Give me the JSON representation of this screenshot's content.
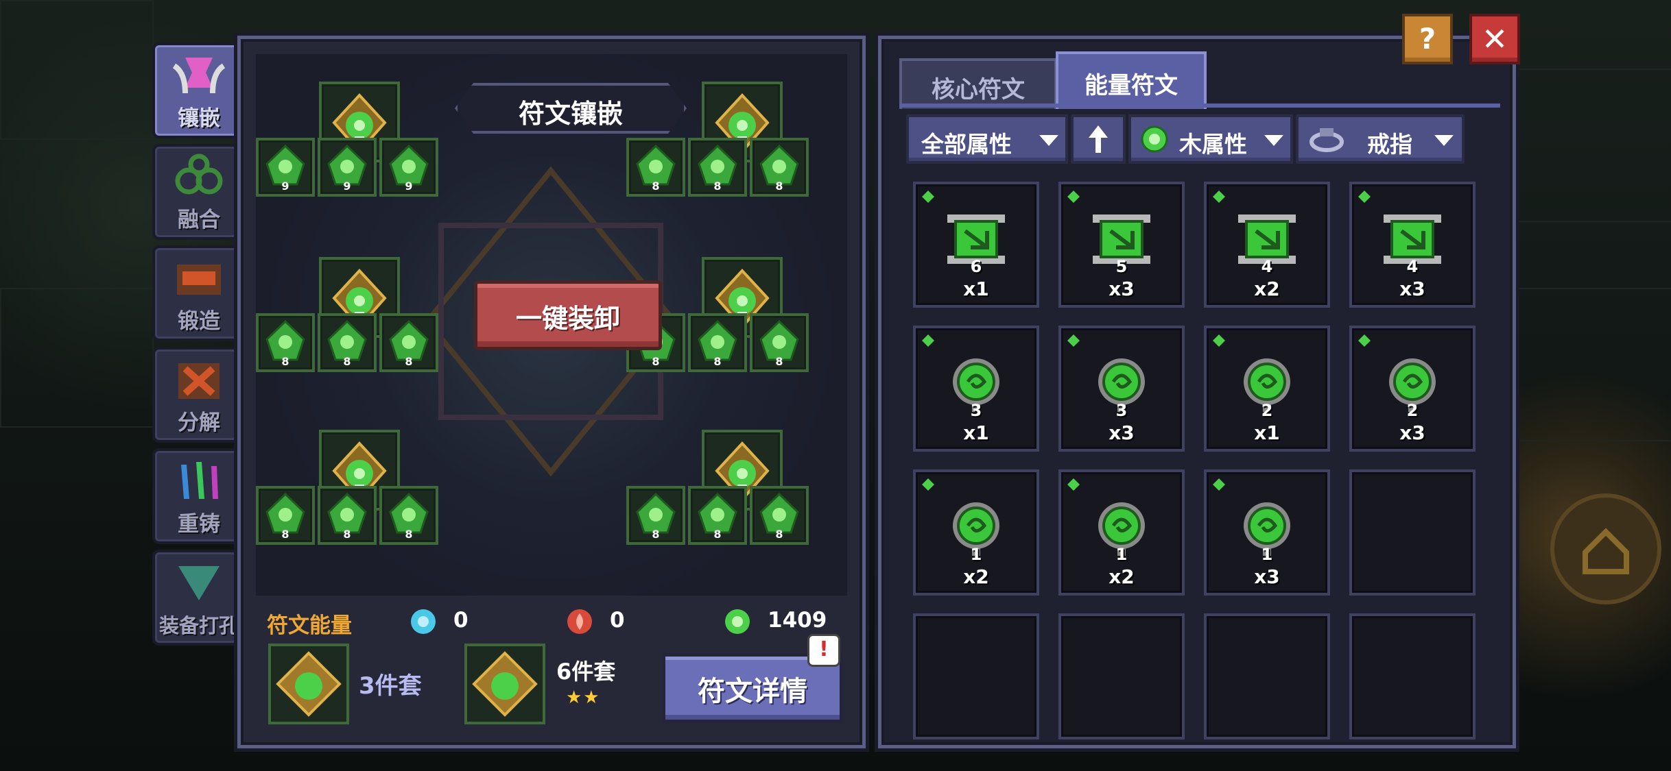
{
  "colors": {
    "accent": "#5b5fa3",
    "rune_green": "#4cd04a",
    "energy_label": "#f0a830",
    "unequip": "#b34c4c"
  },
  "sidebar": {
    "items": [
      {
        "label": "镶嵌",
        "icon": "inlay-icon",
        "active": true
      },
      {
        "label": "融合",
        "icon": "fusion-icon",
        "active": false
      },
      {
        "label": "锻造",
        "icon": "forge-icon",
        "active": false
      },
      {
        "label": "分解",
        "icon": "dismantle-icon",
        "active": false
      },
      {
        "label": "重铸",
        "icon": "recast-icon",
        "active": false
      },
      {
        "label": "装备打孔",
        "icon": "socket-punch-icon",
        "active": false
      }
    ]
  },
  "inlay": {
    "title": "符文镶嵌",
    "unequip_label": "一键装卸",
    "small_slot_levels": [
      "9",
      "9",
      "9",
      "8",
      "8",
      "8",
      "8",
      "8",
      "8",
      "8",
      "8",
      "8",
      "8",
      "8",
      "8",
      "8",
      "8",
      "8"
    ]
  },
  "energy": {
    "label": "符文能量",
    "blue": "0",
    "red": "0",
    "green": "1409"
  },
  "sets": {
    "set3": "3件套",
    "set6": "6件套",
    "set6_stars": "★★",
    "detail_label": "符文详情",
    "alert": "!"
  },
  "tabs": {
    "core": "核心符文",
    "energy": "能量符文"
  },
  "filters": {
    "attribute": "全部属性",
    "sort_icon": "up-arrow-icon",
    "element": "木属性",
    "equip_type": "戒指"
  },
  "runes": [
    {
      "level": "6",
      "count": "x1",
      "shape": "scroll"
    },
    {
      "level": "5",
      "count": "x3",
      "shape": "scroll"
    },
    {
      "level": "4",
      "count": "x2",
      "shape": "scroll"
    },
    {
      "level": "4",
      "count": "x3",
      "shape": "scroll"
    },
    {
      "level": "3",
      "count": "x1",
      "shape": "orb"
    },
    {
      "level": "3",
      "count": "x3",
      "shape": "orb"
    },
    {
      "level": "2",
      "count": "x1",
      "shape": "orb"
    },
    {
      "level": "2",
      "count": "x3",
      "shape": "orb"
    },
    {
      "level": "1",
      "count": "x2",
      "shape": "orb"
    },
    {
      "level": "1",
      "count": "x2",
      "shape": "orb"
    },
    {
      "level": "1",
      "count": "x3",
      "shape": "orb"
    }
  ],
  "window": {
    "help": "?",
    "close": "✕"
  }
}
